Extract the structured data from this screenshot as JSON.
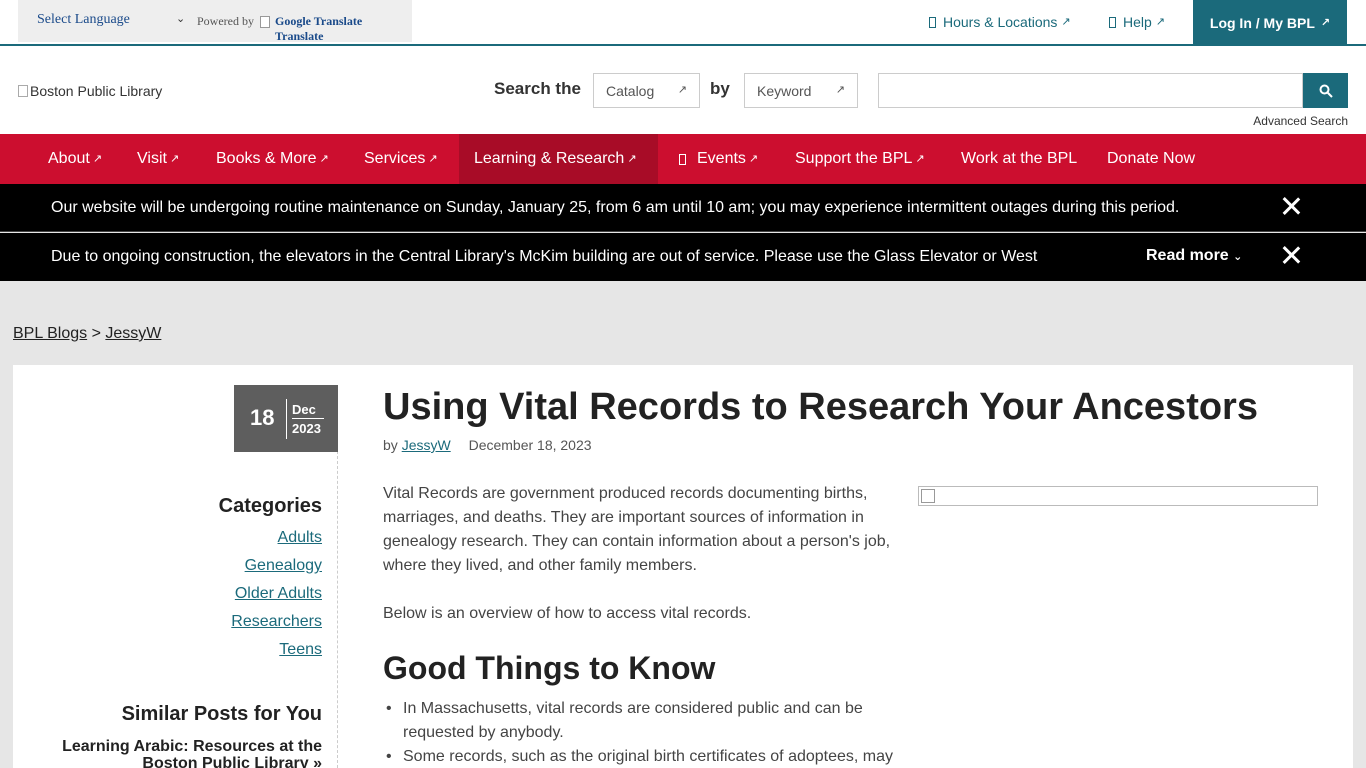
{
  "topbar": {
    "language_select": "Select Language",
    "powered_by": "Powered by",
    "google_translate": "Google Translate",
    "translate": "Translate",
    "hours_locations": "Hours & Locations",
    "help": "Help",
    "login": "Log In / My BPL"
  },
  "header": {
    "logo_alt": "Boston Public Library",
    "search_the": "Search the",
    "catalog_select": "Catalog",
    "by": "by",
    "keyword_select": "Keyword",
    "search_value": "",
    "advanced_search": "Advanced Search"
  },
  "nav": {
    "items": [
      {
        "label": "About"
      },
      {
        "label": "Visit"
      },
      {
        "label": "Books & More"
      },
      {
        "label": "Services"
      },
      {
        "label": "Learning & Research"
      },
      {
        "label": "Events"
      },
      {
        "label": "Support the BPL"
      },
      {
        "label": "Work at the BPL"
      },
      {
        "label": "Donate Now"
      }
    ]
  },
  "alerts": [
    {
      "message": "Our website will be undergoing routine maintenance on Sunday, January 25, from 6 am until 10 am; you may experience intermittent outages during this period."
    },
    {
      "message": "Due to ongoing construction, the elevators in the Central Library's McKim building are out of service. Please use the Glass Elevator or West",
      "read_more": "Read more"
    }
  ],
  "breadcrumb": {
    "blogs": "BPL Blogs",
    "separator": ">",
    "author": "JessyW"
  },
  "post": {
    "date_day": "18",
    "date_month": "Dec",
    "date_year": "2023",
    "title": "Using Vital Records to Research Your Ancestors",
    "by": "by",
    "author": "JessyW",
    "date": "December 18, 2023",
    "para1": "Vital Records are government produced records documenting births, marriages, and deaths. They are important sources of information in genealogy research. They can contain information about a person's job, where they lived, and other family members.",
    "para2": "Below is an overview of how to access vital records.",
    "section_heading": "Good Things to Know",
    "bullets": [
      "In Massachusetts, vital records are considered public and can be requested by anybody.",
      "Some records, such as the original birth certificates of adoptees, may"
    ]
  },
  "sidebar": {
    "categories_heading": "Categories",
    "categories": [
      "Adults",
      "Genealogy",
      "Older Adults",
      "Researchers",
      "Teens"
    ],
    "similar_heading": "Similar Posts for You",
    "similar_first": "Learning Arabic: Resources at the Boston Public Library",
    "similar_suffix": "»"
  }
}
